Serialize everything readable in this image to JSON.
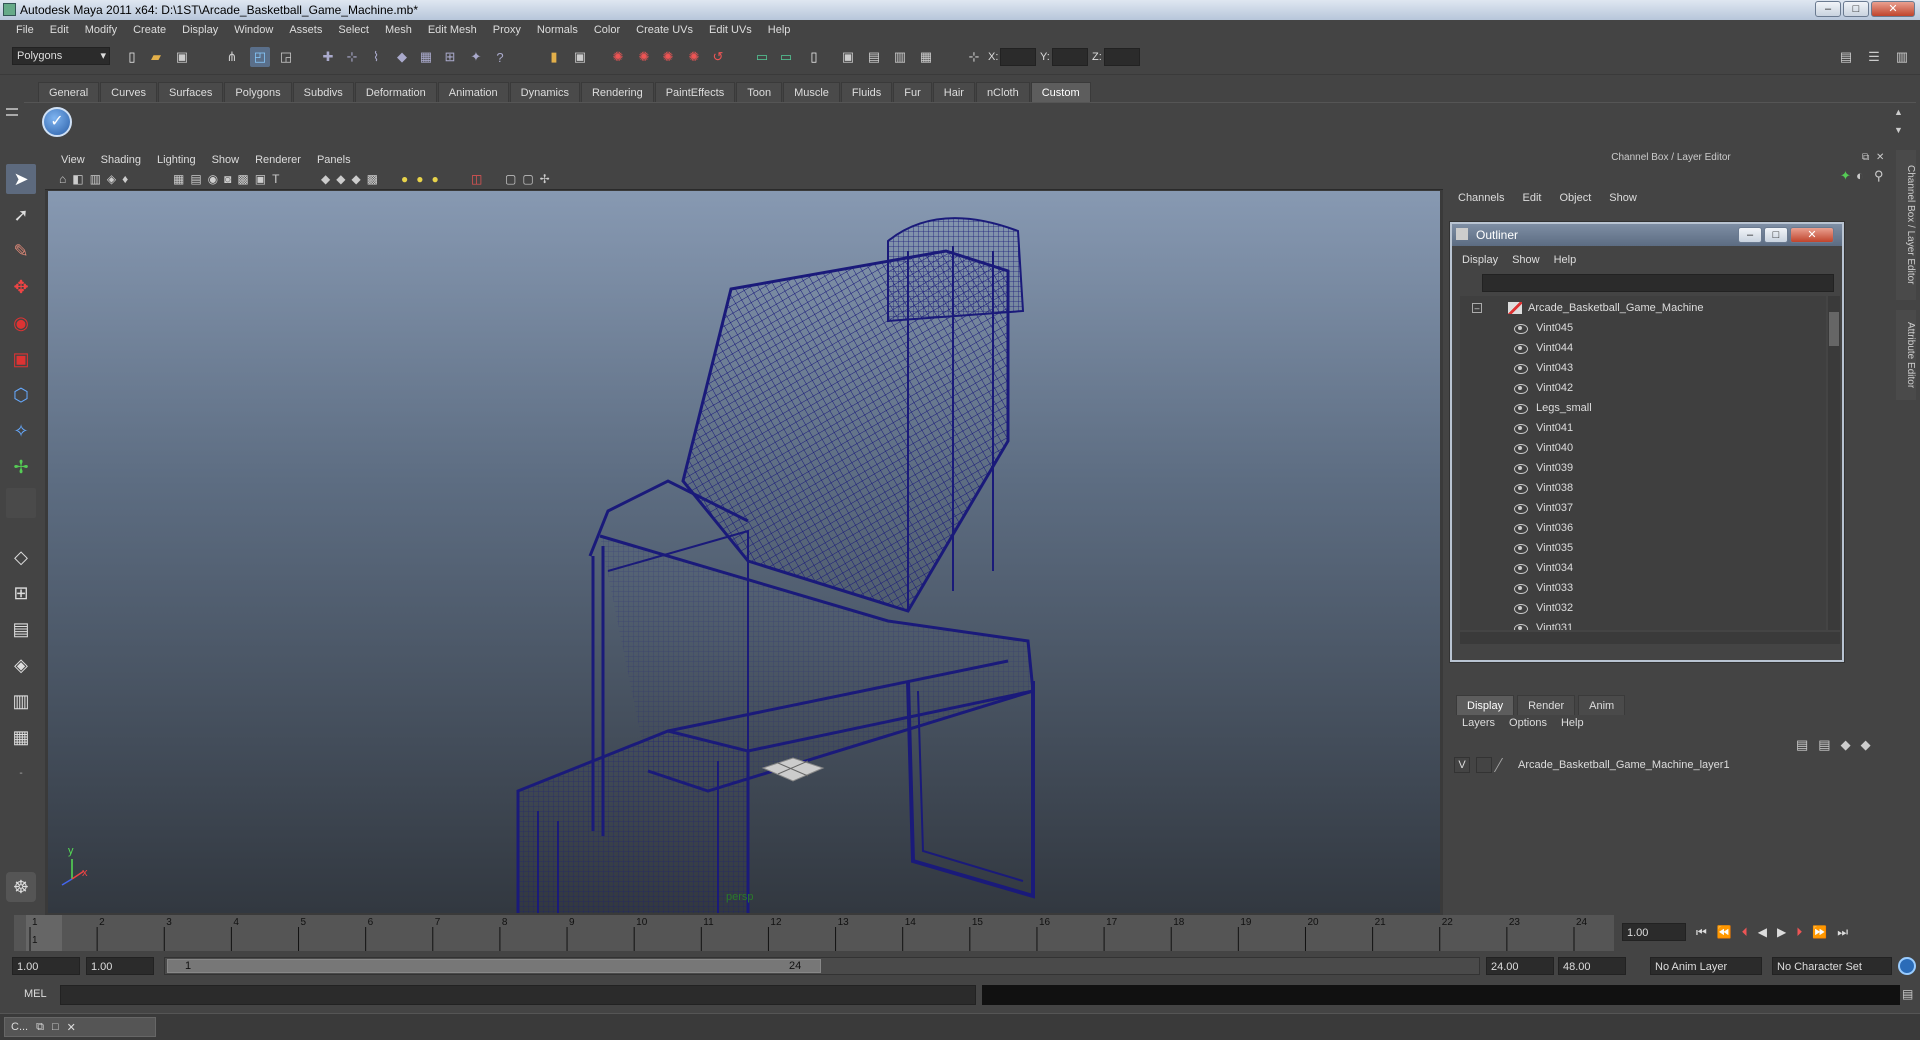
{
  "window": {
    "title": "Autodesk Maya 2011 x64: D:\\1ST\\Arcade_Basketball_Game_Machine.mb*"
  },
  "menubar": [
    "File",
    "Edit",
    "Modify",
    "Create",
    "Display",
    "Window",
    "Assets",
    "Select",
    "Mesh",
    "Edit Mesh",
    "Proxy",
    "Normals",
    "Color",
    "Create UVs",
    "Edit UVs",
    "Help"
  ],
  "statusline": {
    "mode_select": "Polygons",
    "x_label": "X:",
    "y_label": "Y:",
    "z_label": "Z:"
  },
  "shelf_tabs": [
    "General",
    "Curves",
    "Surfaces",
    "Polygons",
    "Subdivs",
    "Deformation",
    "Animation",
    "Dynamics",
    "Rendering",
    "PaintEffects",
    "Toon",
    "Muscle",
    "Fluids",
    "Fur",
    "Hair",
    "nCloth",
    "Custom"
  ],
  "shelf_active": "Custom",
  "viewport": {
    "menu": [
      "View",
      "Shading",
      "Lighting",
      "Show",
      "Renderer",
      "Panels"
    ],
    "camera_label": "persp",
    "axis_x": "x",
    "axis_y": "y"
  },
  "channel_box": {
    "header": "Channel Box / Layer Editor",
    "menu": [
      "Channels",
      "Edit",
      "Object",
      "Show"
    ],
    "side_tabs": [
      "Channel Box / Layer Editor",
      "Attribute Editor"
    ]
  },
  "outliner": {
    "title": "Outliner",
    "menu": [
      "Display",
      "Show",
      "Help"
    ],
    "root": "Arcade_Basketball_Game_Machine",
    "items": [
      "Vint045",
      "Vint044",
      "Vint043",
      "Vint042",
      "Legs_small",
      "Vint041",
      "Vint040",
      "Vint039",
      "Vint038",
      "Vint037",
      "Vint036",
      "Vint035",
      "Vint034",
      "Vint033",
      "Vint032",
      "Vint031"
    ]
  },
  "layer_editor": {
    "tabs": [
      "Display",
      "Render",
      "Anim"
    ],
    "active_tab": "Display",
    "menu": [
      "Layers",
      "Options",
      "Help"
    ],
    "layer_visible": "V",
    "layer_name": "Arcade_Basketball_Game_Machine_layer1"
  },
  "timeline": {
    "ticks": [
      "1",
      "2",
      "3",
      "4",
      "5",
      "6",
      "7",
      "8",
      "9",
      "10",
      "11",
      "12",
      "13",
      "14",
      "15",
      "16",
      "17",
      "18",
      "19",
      "20",
      "21",
      "22",
      "23",
      "24"
    ],
    "current_frame_left": "1",
    "current_time": "1.00"
  },
  "range": {
    "start": "1.00",
    "playback_start": "1.00",
    "slider_start": "1",
    "slider_end": "24",
    "playback_end": "24.00",
    "end": "48.00",
    "anim_layer": "No Anim Layer",
    "character_set": "No Character Set"
  },
  "cmdline": {
    "label": "MEL"
  },
  "taskbar": {
    "label": "C..."
  },
  "colors": {
    "wire": "#1a1a7a",
    "bg_top": "#8799b2",
    "bg_bottom": "#323840",
    "ui": "#444444"
  }
}
